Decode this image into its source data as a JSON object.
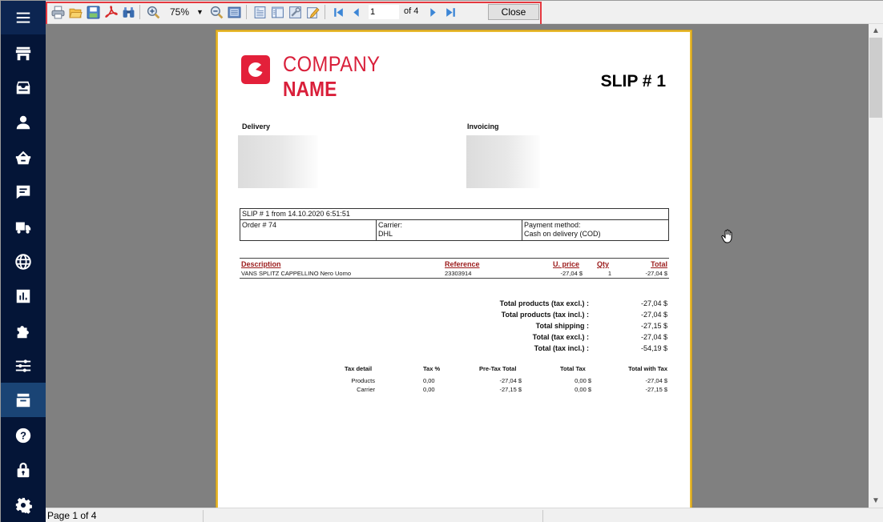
{
  "sidebar": {
    "items": [
      {
        "name": "menu",
        "icon": "hamburger-icon"
      },
      {
        "name": "store",
        "icon": "storefront-icon"
      },
      {
        "name": "inbox",
        "icon": "inbox-tray-icon"
      },
      {
        "name": "customers",
        "icon": "user-icon"
      },
      {
        "name": "basket",
        "icon": "basket-icon"
      },
      {
        "name": "messages",
        "icon": "message-icon"
      },
      {
        "name": "shipping",
        "icon": "truck-icon"
      },
      {
        "name": "international",
        "icon": "globe-icon"
      },
      {
        "name": "stats",
        "icon": "bar-chart-icon"
      },
      {
        "name": "modules",
        "icon": "puzzle-icon"
      },
      {
        "name": "preferences",
        "icon": "sliders-icon"
      },
      {
        "name": "orders-archive",
        "icon": "inbox-tray-icon",
        "active": true
      },
      {
        "name": "help",
        "icon": "question-circle-icon"
      },
      {
        "name": "security",
        "icon": "lock-icon"
      },
      {
        "name": "settings",
        "icon": "gear-icon"
      }
    ]
  },
  "toolbar": {
    "zoom_value": "75%",
    "page_current": "1",
    "page_of": "of 4",
    "close_label": "Close",
    "buttons": [
      "print-icon",
      "open-folder-icon",
      "save-icon",
      "pdf-export-icon",
      "find-icon",
      "zoom-in-icon",
      "zoom-out-icon",
      "page-view-icon",
      "single-page-icon",
      "two-page-icon",
      "properties-icon",
      "edit-icon",
      "first-page-icon",
      "previous-page-icon",
      "next-page-icon",
      "last-page-icon"
    ]
  },
  "status": {
    "page_text": "Page 1 of 4"
  },
  "document": {
    "company_line1": "COMPANY",
    "company_line2": "NAME",
    "slip_title": "SLIP # 1",
    "delivery_label": "Delivery",
    "invoicing_label": "Invoicing",
    "info": {
      "header": "SLIP # 1 from 14.10.2020 6:51:51",
      "order": "Order # 74",
      "carrier_label": "Carrier:",
      "carrier_value": "DHL",
      "payment_label": "Payment method:",
      "payment_value": "Cash on delivery (COD)"
    },
    "items": {
      "headers": {
        "description": "Description",
        "reference": "Reference",
        "unit_price": "U. price",
        "qty": "Qty",
        "total": "Total"
      },
      "rows": [
        {
          "description": "VANS SPLITZ CAPPELLINO Nero Uomo",
          "reference": "23303914",
          "unit_price": "-27,04 $",
          "qty": "1",
          "total": "-27,04 $"
        }
      ]
    },
    "totals": [
      {
        "label": "Total products (tax excl.) :",
        "value": "-27,04 $"
      },
      {
        "label": "Total products (tax incl.) :",
        "value": "-27,04 $"
      },
      {
        "label": "Total shipping :",
        "value": "-27,15 $"
      },
      {
        "label": "Total (tax excl.) :",
        "value": "-27,04 $"
      },
      {
        "label": "Total (tax incl.) :",
        "value": "-54,19 $"
      }
    ],
    "tax_detail": {
      "headers": {
        "detail": "Tax detail",
        "rate": "Tax %",
        "pretax": "Pre-Tax Total",
        "tax": "Total Tax",
        "with_tax": "Total with Tax"
      },
      "rows": [
        {
          "detail": "Products",
          "rate": "0,00",
          "pretax": "-27,04 $",
          "tax": "0,00 $",
          "with_tax": "-27,04 $"
        },
        {
          "detail": "Carrier",
          "rate": "0,00",
          "pretax": "-27,15 $",
          "tax": "0,00 $",
          "with_tax": "-27,15 $"
        }
      ]
    }
  },
  "colors": {
    "sidebar_bg": "#041537",
    "sidebar_active": "#1a4475",
    "brand_red": "#d91f3a",
    "header_red": "#9b1a1a",
    "page_border": "#e8b92f",
    "viewer_bg": "#808080",
    "highlight": "#e5383f"
  }
}
